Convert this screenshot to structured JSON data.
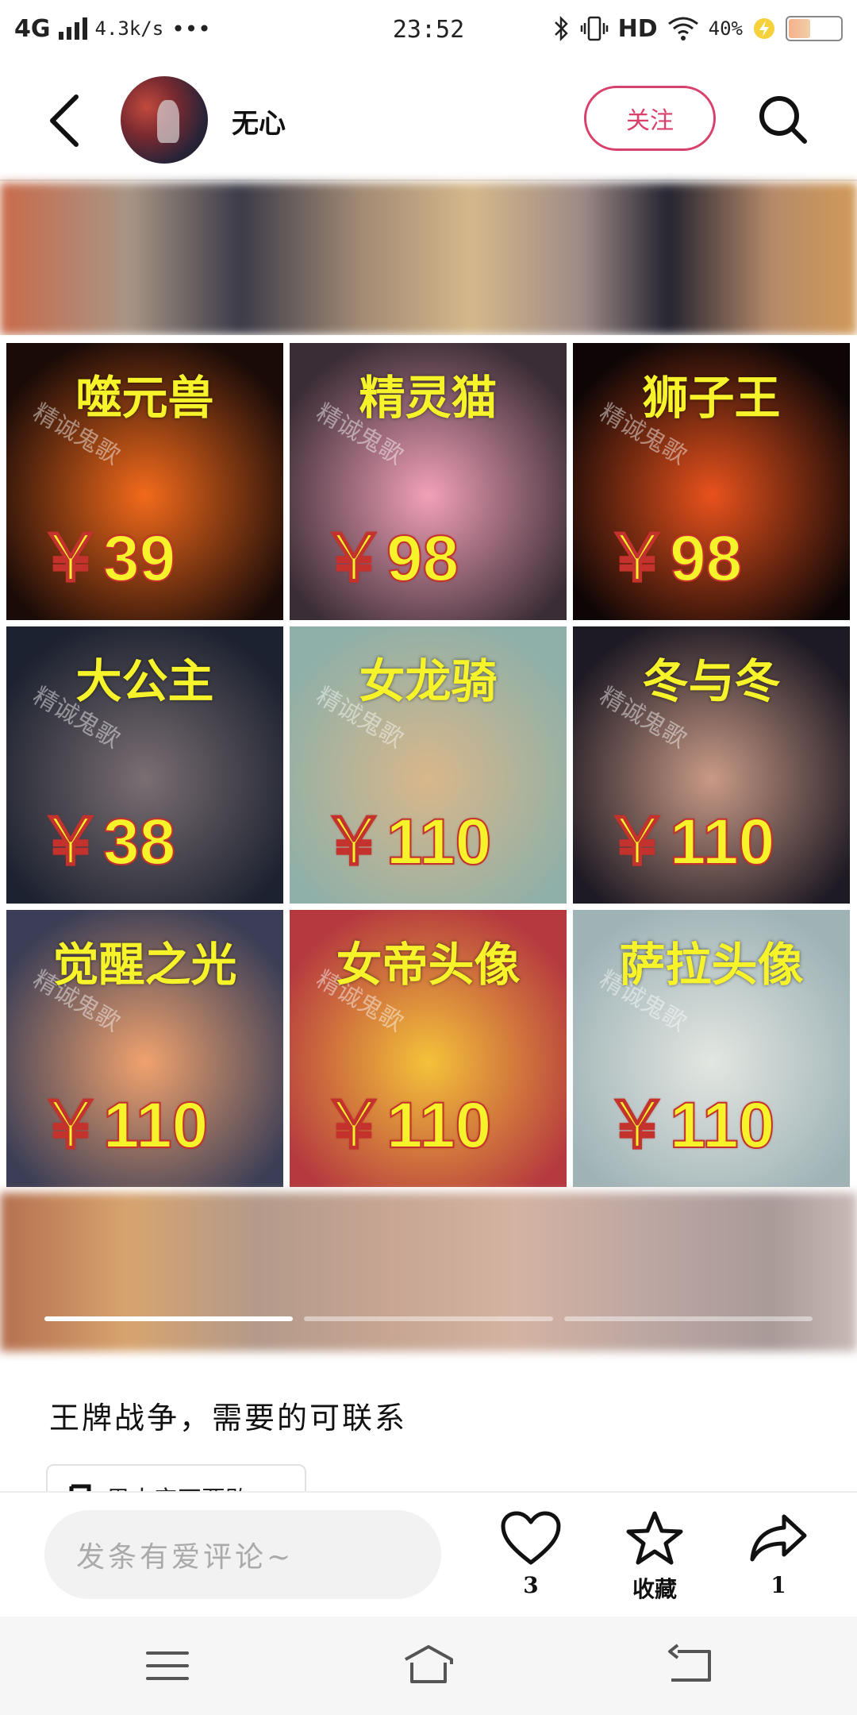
{
  "status_bar": {
    "network": "4G",
    "speed": "4.3k/s",
    "more": "•••",
    "time": "23:52",
    "hd": "HD",
    "battery_percent": "40%",
    "battery_level": 0.4
  },
  "header": {
    "username": "无心",
    "follow_label": "关注"
  },
  "items": [
    {
      "title": "噬元兽",
      "price": "￥39",
      "watermark": "精诚鬼歌",
      "color_a": "#f26a1b",
      "color_b": "#1a0b08"
    },
    {
      "title": "精灵猫",
      "price": "￥98",
      "watermark": "精诚鬼歌",
      "color_a": "#f2a0b8",
      "color_b": "#3a2d35"
    },
    {
      "title": "狮子王",
      "price": "￥98",
      "watermark": "精诚鬼歌",
      "color_a": "#e8521c",
      "color_b": "#0e0606"
    },
    {
      "title": "大公主",
      "price": "￥38",
      "watermark": "精诚鬼歌",
      "color_a": "#7a6e72",
      "color_b": "#1d2230"
    },
    {
      "title": "女龙骑",
      "price": "￥110",
      "watermark": "精诚鬼歌",
      "color_a": "#d9b78a",
      "color_b": "#8fb0a8"
    },
    {
      "title": "冬与冬",
      "price": "￥110",
      "watermark": "精诚鬼歌",
      "color_a": "#c99a86",
      "color_b": "#1e1a24"
    },
    {
      "title": "觉醒之光",
      "price": "￥110",
      "watermark": "精诚鬼歌",
      "color_a": "#f0a26e",
      "color_b": "#3b3e56"
    },
    {
      "title": "女帝头像",
      "price": "￥110",
      "watermark": "精诚鬼歌",
      "color_a": "#f4c23a",
      "color_b": "#b5393f"
    },
    {
      "title": "萨拉头像",
      "price": "￥110",
      "watermark": "精诚鬼歌",
      "color_a": "#e3e6e1",
      "color_b": "#9fb3b6"
    }
  ],
  "carousel": {
    "pages": 3,
    "active_index": 0
  },
  "post": {
    "description": "王牌战争，需要的可联系",
    "music": "男人实不要败"
  },
  "bottom_bar": {
    "comment_placeholder": "发条有爱评论~",
    "like_count": "3",
    "favorite_label": "收藏",
    "share_count": "1"
  },
  "icons": {
    "back": "chevron-left-icon",
    "search": "search-icon",
    "like": "heart-icon",
    "favorite": "star-icon",
    "share": "share-arrow-icon",
    "music": "music-note-icon"
  },
  "colors": {
    "accent": "#d9406b",
    "price_text": "#f6f32a",
    "price_stroke": "#c3322c"
  }
}
